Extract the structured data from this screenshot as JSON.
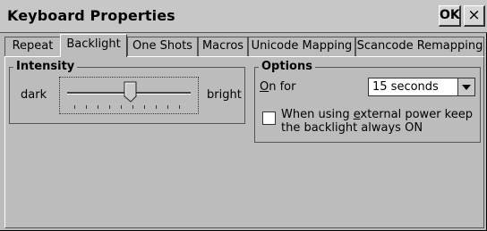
{
  "window": {
    "title": "Keyboard Properties",
    "ok_label": "OK",
    "close_label": "×"
  },
  "tabs": [
    {
      "label": "Repeat",
      "active": false
    },
    {
      "label": "Backlight",
      "active": true
    },
    {
      "label": "One Shots",
      "active": false
    },
    {
      "label": "Macros",
      "active": false
    },
    {
      "label": "Unicode Mapping",
      "active": false
    },
    {
      "label": "Scancode Remapping",
      "active": false
    }
  ],
  "intensity": {
    "label": "Intensity",
    "min_label": "dark",
    "max_label": "bright",
    "value_fraction": 0.5
  },
  "options": {
    "label": "Options",
    "on_for_label_pre": "",
    "on_for_label_underlined": "O",
    "on_for_label_post": "n for",
    "on_for_value": "15 seconds",
    "external_power_line1_pre": "When using ",
    "external_power_line1_underlined": "e",
    "external_power_line1_post": "xternal power keep",
    "external_power_line2": "the backlight always ON",
    "external_power_checked": false
  },
  "icons": {
    "dropdown": "chevron-down-icon",
    "close": "close-icon"
  }
}
